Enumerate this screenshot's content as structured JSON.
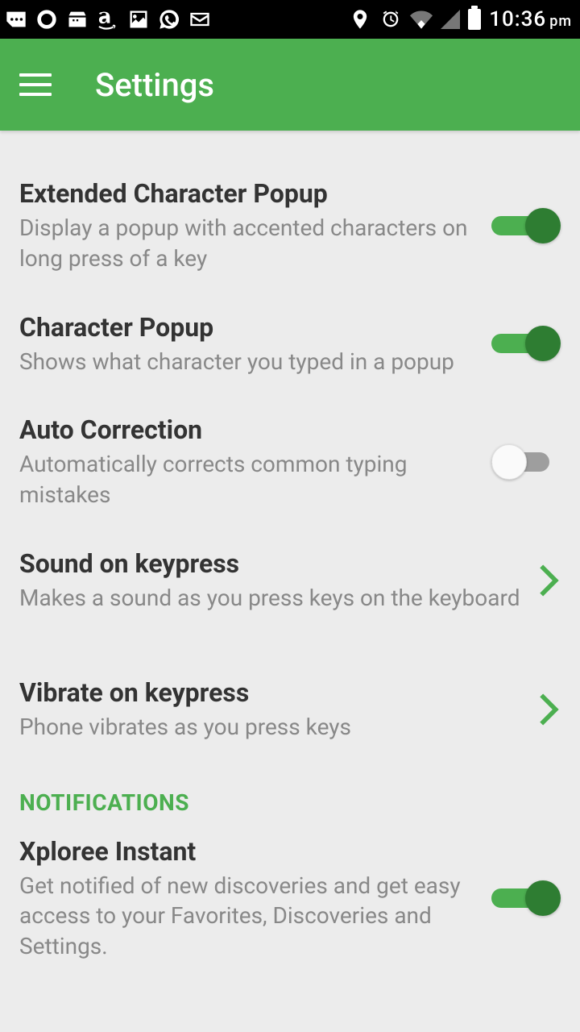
{
  "status": {
    "time": "10:36",
    "ampm": "pm"
  },
  "header": {
    "title": "Settings"
  },
  "settings": [
    {
      "title": "Extended Character Popup",
      "sub": "Display a popup with accented characters on long press of a key",
      "type": "toggle",
      "value": true
    },
    {
      "title": "Character Popup",
      "sub": "Shows what character you typed in a popup",
      "type": "toggle",
      "value": true
    },
    {
      "title": "Auto Correction",
      "sub": "Automatically corrects common typing mistakes",
      "type": "toggle",
      "value": false
    },
    {
      "title": "Sound on keypress",
      "sub": "Makes a sound as you press keys on the keyboard",
      "type": "nav"
    },
    {
      "title": "Vibrate on keypress",
      "sub": "Phone vibrates as you press keys",
      "type": "nav"
    }
  ],
  "section": {
    "label": "NOTIFICATIONS"
  },
  "notifications": [
    {
      "title": "Xploree Instant",
      "sub": "Get notified of new discoveries and get easy access to your Favorites, Discoveries and Settings.",
      "type": "toggle",
      "value": true
    }
  ]
}
